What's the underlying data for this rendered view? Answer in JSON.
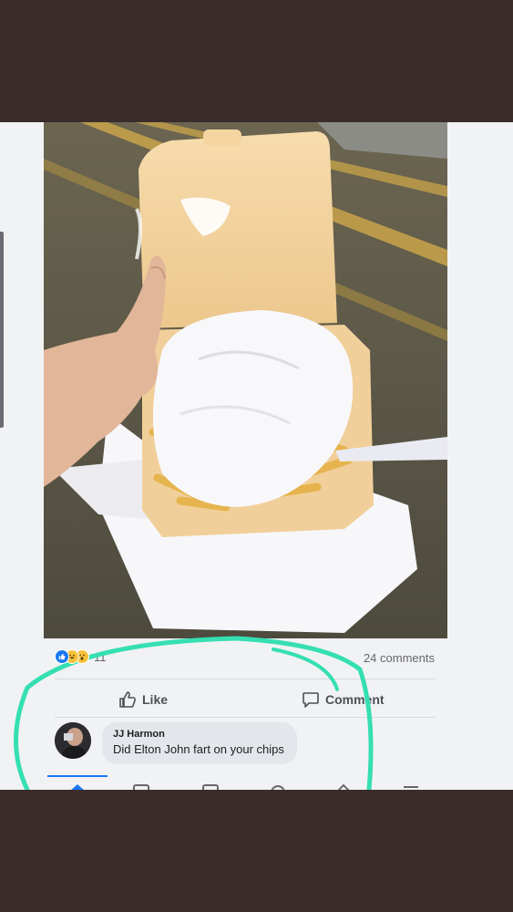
{
  "post": {
    "reaction_count": "11",
    "comments_count": "24 comments"
  },
  "actions": {
    "like_label": "Like",
    "comment_label": "Comment"
  },
  "comment": {
    "author": "JJ Harmon",
    "text": "Did Elton John fart on your chips"
  },
  "icons": {
    "reactions": [
      "like-icon",
      "haha-icon",
      "wow-icon"
    ],
    "actions": [
      "thumbs-up-icon",
      "comment-icon"
    ],
    "bottom_nav": [
      "home-icon",
      "video-icon",
      "marketplace-icon",
      "notifications-icon",
      "menu-icon"
    ]
  },
  "colors": {
    "frame": "#3b2c2c",
    "screen_background": "#f1f2f4",
    "facebook_blue": "#1877f2",
    "comment_bubble": "#e4e6eb",
    "annotation_circle": "#35dfb1"
  }
}
